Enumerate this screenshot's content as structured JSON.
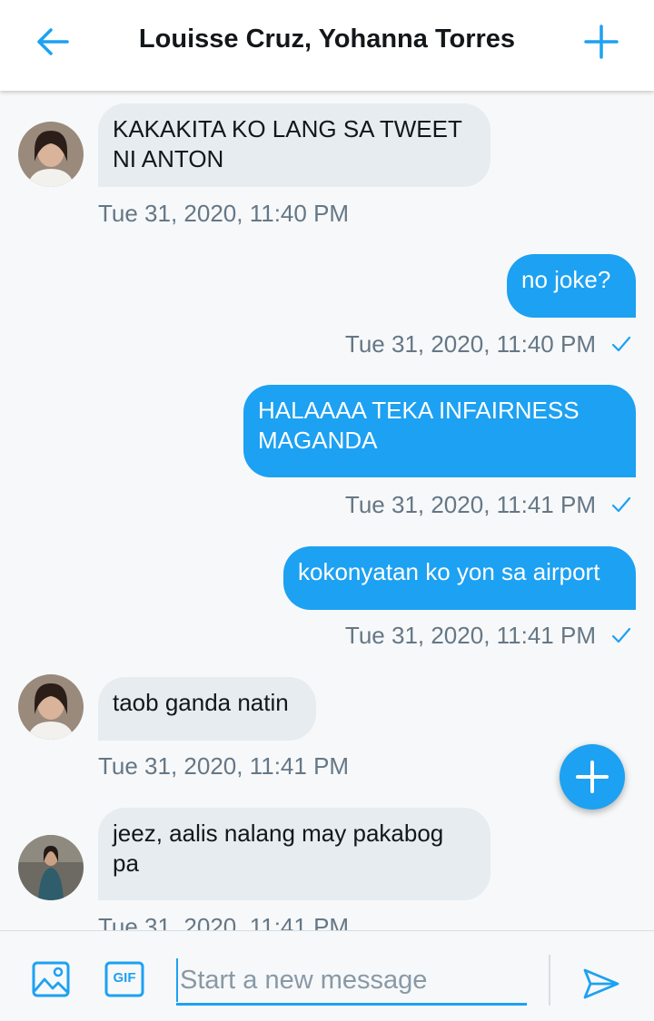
{
  "header": {
    "title": "Louisse Cruz, Yohanna Torres",
    "back_icon": "arrow-left-icon",
    "add_icon": "plus-icon"
  },
  "messages": [
    {
      "direction": "in",
      "text": "KAKAKITA KO LANG SA TWEET NI ANTON",
      "timestamp": "Tue 31, 2020, 11:40 PM"
    },
    {
      "direction": "out",
      "text": "no joke?",
      "timestamp": "Tue 31, 2020, 11:40 PM"
    },
    {
      "direction": "out",
      "text": "HALAAAA TEKA INFAIRNESS MAGANDA",
      "timestamp": "Tue 31, 2020, 11:41 PM"
    },
    {
      "direction": "out",
      "text": "kokonyatan ko yon sa airport",
      "timestamp": "Tue 31, 2020, 11:41 PM"
    },
    {
      "direction": "in",
      "text": "taob ganda natin",
      "timestamp": "Tue 31, 2020, 11:41 PM"
    },
    {
      "direction": "in",
      "text": "jeez, aalis nalang may pakabog pa",
      "timestamp": "Tue 31, 2020, 11:41 PM"
    }
  ],
  "composer": {
    "placeholder": "Start a new message",
    "gif_label": "GIF"
  },
  "colors": {
    "accent": "#1da1f2",
    "incoming_bubble": "#e6ecf0",
    "timestamp": "#657786",
    "background": "#f7f8f9"
  }
}
